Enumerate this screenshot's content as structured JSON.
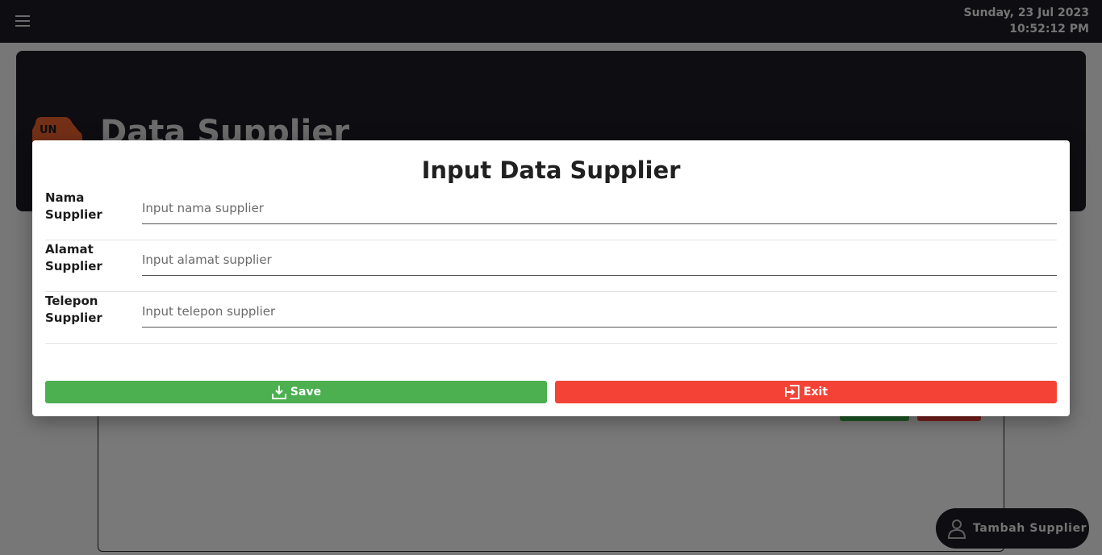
{
  "topbar": {
    "menu_icon": "hamburger-menu-icon",
    "date": "Sunday, 23 Jul 2023",
    "time": "10:52:12 PM"
  },
  "page": {
    "logo_text": "UN",
    "title": "Data Supplier",
    "fab_label": "Tambah Supplier",
    "fab_icon": "person-icon"
  },
  "modal": {
    "title": "Input Data Supplier",
    "fields": [
      {
        "label_line1": "Nama",
        "label_line2": "Supplier",
        "placeholder": "Input nama supplier",
        "value": ""
      },
      {
        "label_line1": "Alamat",
        "label_line2": "Supplier",
        "placeholder": "Input alamat supplier",
        "value": ""
      },
      {
        "label_line1": "Telepon",
        "label_line2": "Supplier",
        "placeholder": "Input telepon supplier",
        "value": ""
      }
    ],
    "save_label": "Save",
    "exit_label": "Exit"
  },
  "colors": {
    "topbar": "#1c1b22",
    "save": "#4caf50",
    "exit": "#f44336",
    "logo": "#e8602c"
  }
}
